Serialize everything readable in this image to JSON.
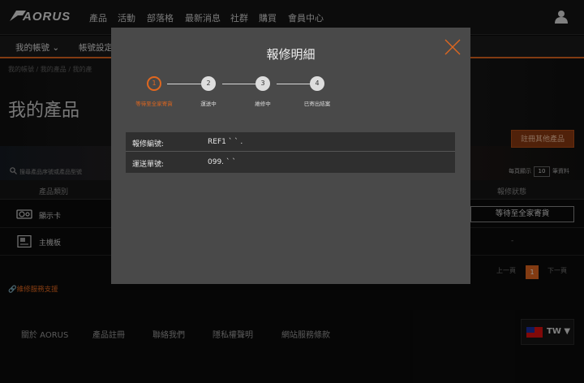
{
  "topnav": {
    "logo": "AORUS",
    "items": [
      "產品",
      "活動",
      "部落格",
      "最新消息",
      "社群",
      "購買",
      "會員中心"
    ]
  },
  "subnav": {
    "my_account": "我的帳號",
    "account_settings": "帳號設定"
  },
  "breadcrumb": "我的帳號  /  我的產品  /  我的產",
  "page": {
    "title": "我的產品",
    "register_other": "註冊其他產品",
    "search_placeholder": "搜尋產品序號或產品型號",
    "per_page_label": "每頁顯示",
    "per_page_value": "10",
    "per_page_unit": "筆資料"
  },
  "table": {
    "headers": {
      "category": "產品類別",
      "status": "報修狀態"
    },
    "rows": [
      {
        "category": "顯示卡",
        "icon": "graphics-card-icon",
        "status": "等待至全家寄貨"
      },
      {
        "category": "主機板",
        "icon": "motherboard-icon",
        "status": "-"
      }
    ]
  },
  "pager": {
    "prev": "上一頁",
    "current": "1",
    "next": "下一頁"
  },
  "support_link": "維修服務支援",
  "footer": {
    "links": [
      "關於 AORUS",
      "產品註冊",
      "聯絡我們",
      "隱私權聲明",
      "網站服務條款"
    ],
    "language": "TW ▼"
  },
  "modal": {
    "title": "報修明細",
    "steps": [
      {
        "number": "1",
        "label": "等待至全家寄貨",
        "active": true
      },
      {
        "number": "2",
        "label": "運送中",
        "active": false
      },
      {
        "number": "3",
        "label": "維修中",
        "active": false
      },
      {
        "number": "4",
        "label": "已寄出結案",
        "active": false
      }
    ],
    "info": [
      {
        "key": "報修編號:",
        "value": "REF1 ` ` ."
      },
      {
        "key": "運送單號:",
        "value": "099.     ` `"
      }
    ]
  },
  "colors": {
    "accent": "#e0671f",
    "modal_bg": "#494949"
  }
}
